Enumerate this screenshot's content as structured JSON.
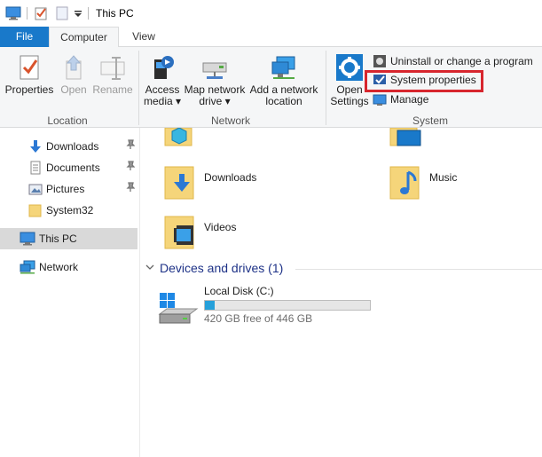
{
  "window": {
    "title": "This PC"
  },
  "tabs": [
    {
      "label": "File"
    },
    {
      "label": "Computer",
      "active": true
    },
    {
      "label": "View"
    }
  ],
  "ribbon": {
    "location": {
      "group_label": "Location",
      "buttons": [
        {
          "label": "Properties",
          "enabled": true
        },
        {
          "label": "Open",
          "enabled": false
        },
        {
          "label": "Rename",
          "enabled": false
        }
      ]
    },
    "network": {
      "group_label": "Network",
      "buttons": [
        {
          "label": "Access",
          "label2": "media ▾"
        },
        {
          "label": "Map network",
          "label2": "drive ▾"
        },
        {
          "label": "Add a network",
          "label2": "location"
        }
      ]
    },
    "system": {
      "group_label": "System",
      "open_settings": {
        "label": "Open",
        "label2": "Settings"
      },
      "small_buttons": [
        {
          "label": "Uninstall or change a program"
        },
        {
          "label": "System properties",
          "highlighted": true
        },
        {
          "label": "Manage"
        }
      ]
    }
  },
  "nav": {
    "items": [
      {
        "label": "Downloads",
        "pinned": true
      },
      {
        "label": "Documents",
        "pinned": true
      },
      {
        "label": "Pictures",
        "pinned": true
      },
      {
        "label": "System32",
        "pinned": false
      },
      {
        "label": "This PC",
        "selected": true
      },
      {
        "label": "Network"
      }
    ]
  },
  "content": {
    "folders": [
      {
        "label": "Downloads"
      },
      {
        "label": "Music"
      },
      {
        "label": "Videos"
      }
    ],
    "devices_section": {
      "label": "Devices and drives (1)"
    },
    "drive": {
      "name": "Local Disk (C:)",
      "free_text": "420 GB free of 446 GB",
      "used_fraction": 0.06
    }
  },
  "colors": {
    "accent": "#1979ca",
    "highlight": "#d7262e",
    "section": "#1e3287",
    "drive_fill": "#26a0da"
  }
}
